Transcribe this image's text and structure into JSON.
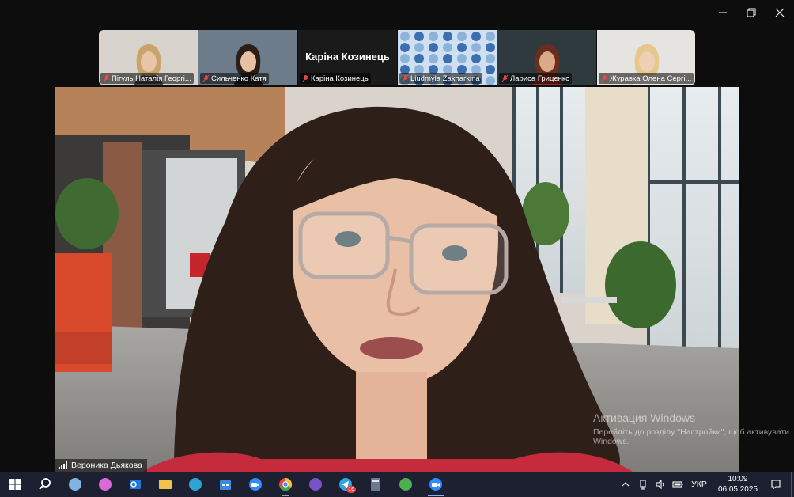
{
  "window_controls": {
    "minimize": "minimize-icon",
    "restore": "restore-icon",
    "close": "close-icon"
  },
  "participants": [
    {
      "name": "Пігуль Наталія Георгі...",
      "muted": true,
      "bg": "#d8d3cc",
      "skin": "#e8c4a8",
      "hair": "#c9a46a",
      "shirt": "#4a4a4a"
    },
    {
      "name": "Сильченко Катя",
      "muted": true,
      "bg": "#6d7c8a",
      "skin": "#e7c1a3",
      "hair": "#2c1e16",
      "shirt": "#1a1a1a"
    },
    {
      "name": "Каріна Козинець",
      "muted": true,
      "big": "Каріна Козинець",
      "bg": "#1a1a1a"
    },
    {
      "name": "Liudmyla Zakharkina",
      "muted": true,
      "bg": "#cfe0f2",
      "pattern": true
    },
    {
      "name": "Лариса Гриценко",
      "muted": true,
      "bg": "#2f3a3e",
      "skin": "#d9a98a",
      "hair": "#6a2e1e",
      "shirt": "#a02828"
    },
    {
      "name": "Журавка Олена Сергі...",
      "muted": true,
      "bg": "#e6e4e0",
      "skin": "#efcfb6",
      "hair": "#e6c98a",
      "shirt": "#f3f1ee"
    }
  ],
  "speaker": {
    "name": "Вероника Дьякова"
  },
  "watermark": {
    "line1": "Активация Windows",
    "line2": "Перейдіть до розділу \"Настройки\", щоб активувати Windows."
  },
  "taskbar": {
    "items": [
      {
        "name": "start-icon",
        "color": "#ffffff"
      },
      {
        "name": "search-icon",
        "color": "#ffffff"
      },
      {
        "name": "app-feather-icon",
        "color": "#7fb3e0"
      },
      {
        "name": "copilot-icon",
        "color": "#d86bd8"
      },
      {
        "name": "outlook-icon",
        "color": "#1e78d4"
      },
      {
        "name": "file-explorer-icon",
        "color": "#f2c34a"
      },
      {
        "name": "edge-icon",
        "color": "#2fa3d8"
      },
      {
        "name": "store-icon",
        "color": "#3a8be0"
      },
      {
        "name": "zoom-icon",
        "color": "#2d8cff"
      },
      {
        "name": "chrome-icon",
        "color": "#e54b3c",
        "open": true
      },
      {
        "name": "viber-icon",
        "color": "#7b51c9"
      },
      {
        "name": "telegram-icon",
        "color": "#2ca5e0",
        "badge": "16"
      },
      {
        "name": "calculator-icon",
        "color": "#6d7a8c"
      },
      {
        "name": "utorrent-icon",
        "color": "#4caf50"
      },
      {
        "name": "zoom-meeting-icon",
        "color": "#2d8cff",
        "active": true
      }
    ],
    "tray": {
      "chevron": "chevron-up-icon",
      "network": "network-icon",
      "volume": "volume-icon",
      "battery": "battery-icon",
      "language": "УКР",
      "time": "10:09",
      "date": "06.05.2025",
      "notifications": "notification-icon"
    }
  }
}
